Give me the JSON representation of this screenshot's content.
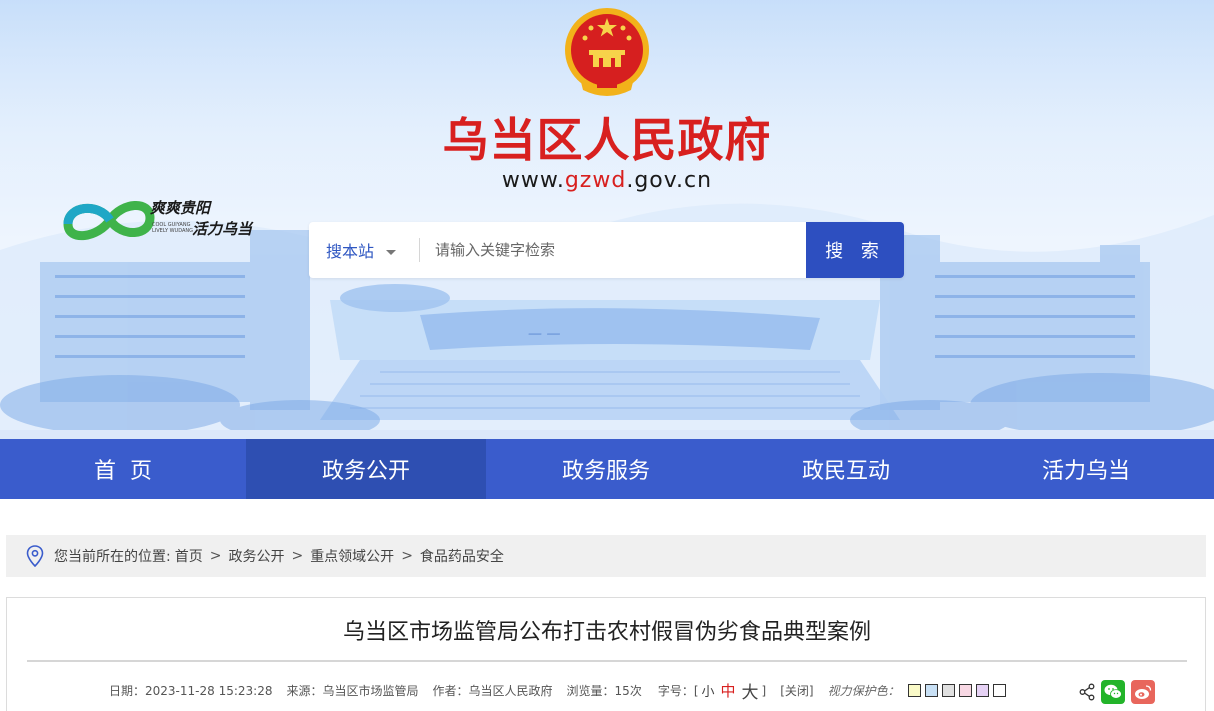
{
  "header": {
    "title": "乌当区人民政府",
    "url_prefix": "www.",
    "url_highlight": "gzwd",
    "url_suffix": ".gov.cn",
    "slogan_line1": "爽爽贵阳",
    "slogan_line2": "活力乌当",
    "slogan_en_line1": "COOL GUIYANG",
    "slogan_en_line2": "LIVELY WUDANG"
  },
  "search": {
    "scope": "搜本站",
    "placeholder": "请输入关键字检索",
    "button_label": "搜 索"
  },
  "nav": {
    "items": [
      {
        "label": "首页"
      },
      {
        "label": "政务公开"
      },
      {
        "label": "政务服务"
      },
      {
        "label": "政民互动"
      },
      {
        "label": "活力乌当"
      }
    ],
    "active_index": 1
  },
  "breadcrumb": {
    "prefix": "您当前所在的位置:",
    "items": [
      "首页",
      "政务公开",
      "重点领域公开",
      "食品药品安全"
    ],
    "separator": ">"
  },
  "article": {
    "title": "乌当区市场监管局公布打击农村假冒伪劣食品典型案例",
    "date_label": "日期：",
    "date": "2023-11-28 15:23:28",
    "source_label": "来源：",
    "source": "乌当区市场监管局",
    "author_label": "作者：",
    "author": "乌当区人民政府",
    "views_label": "浏览量：",
    "views": "15次",
    "font_label": "字号：[",
    "font_small": "小",
    "font_medium": "中",
    "font_large": "大",
    "font_close_bracket": "]",
    "close_label": "[关闭]",
    "eye_label": "视力保护色：",
    "swatches": [
      "#fafac8",
      "#c8e0f5",
      "#e0e0e0",
      "#f8d8e4",
      "#e6d2f5",
      "#ffffff"
    ]
  },
  "colors": {
    "brand_red": "#d8201f",
    "nav_blue": "#3a5ccc",
    "nav_active": "#2e4fb2",
    "search_button": "#2d4fc0"
  },
  "icons": {
    "emblem": "national-emblem",
    "pin": "location-pin-icon",
    "share": "share-icon",
    "wechat": "wechat-icon",
    "weibo": "weibo-icon"
  }
}
